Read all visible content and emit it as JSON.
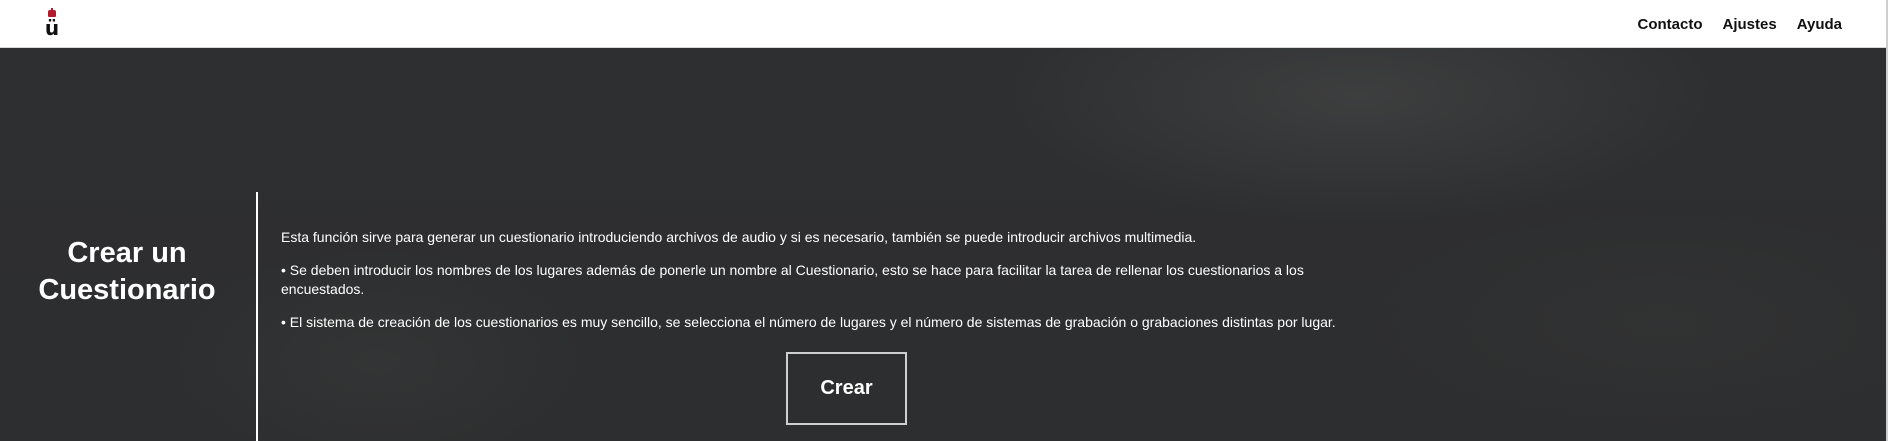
{
  "navbar": {
    "logo": {
      "letter": "ü",
      "icon": "crown-icon",
      "accent": "#b31b2d"
    },
    "links": [
      "Contacto",
      "Ajustes",
      "Ayuda"
    ]
  },
  "hero": {
    "title": "Crear un Cuestionario",
    "paragraphs": [
      "Esta función sirve para generar un cuestionario introduciendo archivos de audio y si es necesario, también se puede introducir archivos multimedia.",
      "• Se deben introducir los nombres de los lugares además de ponerle un nombre al Cuestionario, esto se hace para facilitar la tarea de rellenar los cuestionarios a los encuestados.",
      "• El sistema de creación de los cuestionarios es muy sencillo, se selecciona el número de lugares y el número de sistemas de grabación o grabaciones distintas por lugar."
    ],
    "button_label": "Crear"
  },
  "colors": {
    "navbar_bg": "#ffffff",
    "hero_bg": "#2e2f30",
    "text_light": "#ffffff",
    "text_dark": "#111111"
  }
}
